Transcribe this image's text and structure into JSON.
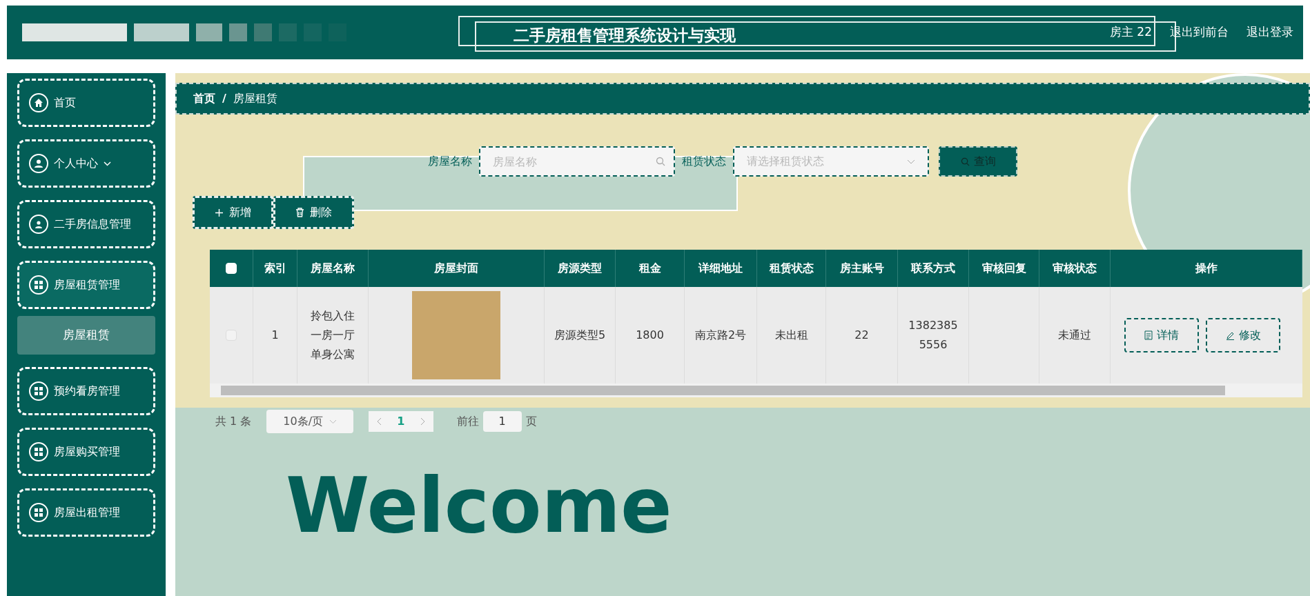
{
  "header": {
    "title": "二手房租售管理系统设计与实现",
    "user": "房主 22",
    "links": [
      "退出到前台",
      "退出登录"
    ]
  },
  "sidebar": {
    "items": [
      {
        "label": "首页",
        "kind": "home",
        "chevron": false,
        "expanded": false
      },
      {
        "label": "个人中心",
        "kind": "user",
        "chevron": true,
        "expanded": false
      },
      {
        "label": "二手房信息管理",
        "kind": "badge",
        "chevron": false,
        "expanded": false
      },
      {
        "label": "房屋租赁管理",
        "kind": "grid",
        "chevron": false,
        "expanded": true,
        "children": [
          {
            "label": "房屋租赁",
            "selected": true
          }
        ]
      },
      {
        "label": "预约看房管理",
        "kind": "grid",
        "chevron": false,
        "expanded": false
      },
      {
        "label": "房屋购买管理",
        "kind": "grid",
        "chevron": false,
        "expanded": false
      },
      {
        "label": "房屋出租管理",
        "kind": "grid",
        "chevron": false,
        "expanded": false
      }
    ]
  },
  "breadcrumb": {
    "items": [
      "首页",
      "房屋租赁"
    ],
    "separator": "/"
  },
  "search": {
    "name_label": "房屋名称",
    "name_placeholder": "房屋名称",
    "status_label": "租赁状态",
    "status_placeholder": "请选择租赁状态",
    "button": "查询"
  },
  "actions": [
    "新增",
    "删除"
  ],
  "table": {
    "columns": [
      "索引",
      "房屋名称",
      "房屋封面",
      "房源类型",
      "租金",
      "详细地址",
      "租赁状态",
      "房主账号",
      "联系方式",
      "审核回复",
      "审核状态",
      "操作"
    ],
    "header_checked": false,
    "rows": [
      {
        "checked": false,
        "cells": [
          "1",
          "拎包入住一房一厅单身公寓",
          null,
          "房源类型5",
          "1800",
          "南京路2号",
          "未出租",
          "22",
          "13823855556",
          "",
          "未通过"
        ],
        "buttons": [
          "详情",
          "修改"
        ]
      }
    ]
  },
  "pagination": {
    "total": "共 1 条",
    "page_size": "10条/页",
    "pages": [
      {
        "label": "1",
        "selected": true
      }
    ],
    "goto_label": "前往",
    "goto_value": "1",
    "goto_suffix": "页"
  },
  "welcome": "Welcome"
}
